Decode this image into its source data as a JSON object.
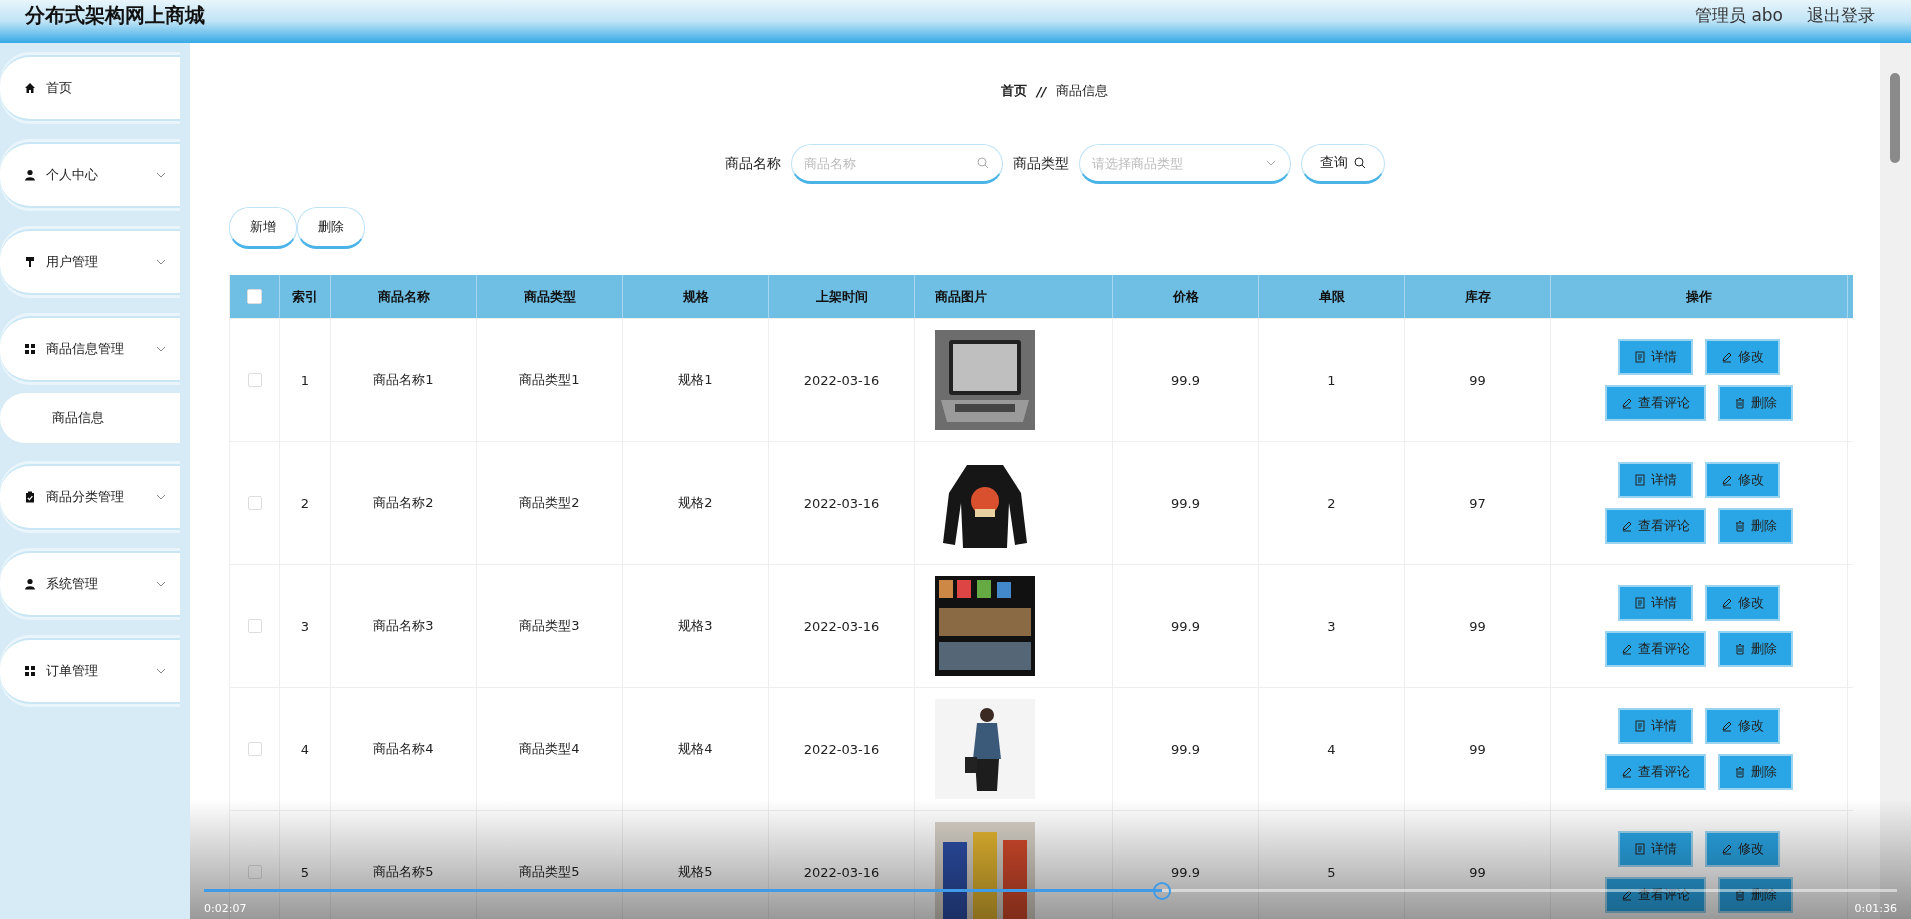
{
  "header": {
    "title": "分布式架构网上商城",
    "user": "管理员 abo",
    "logout": "退出登录"
  },
  "sidebar": {
    "items": [
      {
        "label": "首页",
        "expandable": false
      },
      {
        "label": "个人中心",
        "expandable": true
      },
      {
        "label": "用户管理",
        "expandable": true
      },
      {
        "label": "商品信息管理",
        "expandable": true,
        "children": [
          {
            "label": "商品信息"
          }
        ]
      },
      {
        "label": "商品分类管理",
        "expandable": true
      },
      {
        "label": "系统管理",
        "expandable": true
      },
      {
        "label": "订单管理",
        "expandable": true
      }
    ]
  },
  "breadcrumb": {
    "items": [
      "首页",
      "商品信息"
    ],
    "separator": "//"
  },
  "search": {
    "fields": [
      {
        "kind": "text",
        "label": "商品名称",
        "placeholder": "商品名称"
      },
      {
        "kind": "select",
        "label": "商品类型",
        "placeholder": "请选择商品类型"
      }
    ],
    "button": "查询"
  },
  "toolbar": [
    "新增",
    "删除"
  ],
  "table": {
    "all_checked": false,
    "columns": [
      "索引",
      "商品名称",
      "商品类型",
      "规格",
      "上架时间",
      "商品图片",
      "价格",
      "单限",
      "库存",
      "操作"
    ],
    "rows": [
      {
        "checked": false,
        "cells": [
          "1",
          "商品名称1",
          "商品类型1",
          "规格1",
          "2022-03-16"
        ],
        "image": {
          "kind": "picture"
        },
        "tail": [
          "99.9",
          "1",
          "99"
        ],
        "actions": [
          "详情",
          "修改",
          "查看评论",
          "删除"
        ]
      },
      {
        "checked": false,
        "cells": [
          "2",
          "商品名称2",
          "商品类型2",
          "规格2",
          "2022-03-16"
        ],
        "image": {
          "kind": "picture"
        },
        "tail": [
          "99.9",
          "2",
          "97"
        ],
        "actions": [
          "详情",
          "修改",
          "查看评论",
          "删除"
        ]
      },
      {
        "checked": false,
        "cells": [
          "3",
          "商品名称3",
          "商品类型3",
          "规格3",
          "2022-03-16"
        ],
        "image": {
          "kind": "picture"
        },
        "tail": [
          "99.9",
          "3",
          "99"
        ],
        "actions": [
          "详情",
          "修改",
          "查看评论",
          "删除"
        ]
      },
      {
        "checked": false,
        "cells": [
          "4",
          "商品名称4",
          "商品类型4",
          "规格4",
          "2022-03-16"
        ],
        "image": {
          "kind": "picture"
        },
        "tail": [
          "99.9",
          "4",
          "99"
        ],
        "actions": [
          "详情",
          "修改",
          "查看评论",
          "删除"
        ]
      },
      {
        "checked": false,
        "cells": [
          "5",
          "商品名称5",
          "商品类型5",
          "规格5",
          "2022-03-16"
        ],
        "image": {
          "kind": "picture"
        },
        "tail": [
          "99.9",
          "5",
          "99"
        ],
        "actions": [
          "详情",
          "修改",
          "查看评论",
          "删除"
        ]
      }
    ]
  },
  "player": {
    "elapsed": "0:02:07",
    "remaining": "0:01:36",
    "level": 0.566
  }
}
